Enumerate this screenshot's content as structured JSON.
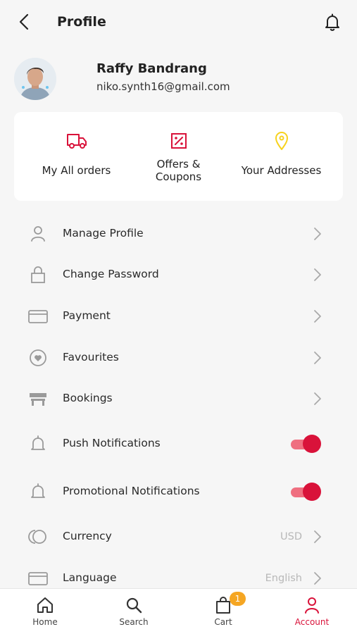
{
  "header": {
    "title": "Profile",
    "back_icon": "chevron-left-icon",
    "notification_icon": "bell-icon"
  },
  "user": {
    "name": "Raffy Bandrang",
    "email": "niko.synth16@gmail.com"
  },
  "quick_actions": [
    {
      "label": "My All orders",
      "icon": "truck-icon",
      "color": "#d9123a"
    },
    {
      "label_line1": "Offers &",
      "label_line2": "Coupons",
      "icon": "percent-icon",
      "color": "#d9123a"
    },
    {
      "label": "Your Addresses",
      "icon": "location-pin-icon",
      "color": "#f7d21e"
    }
  ],
  "menu": [
    {
      "label": "Manage Profile",
      "icon": "user-icon"
    },
    {
      "label": "Change Password",
      "icon": "lock-icon"
    },
    {
      "label": "Payment",
      "icon": "card-icon"
    },
    {
      "label": "Favourites",
      "icon": "heart-icon"
    },
    {
      "label": "Bookings",
      "icon": "bench-icon"
    },
    {
      "label": "Push Notifications",
      "icon": "bell-icon",
      "toggle_on": true
    },
    {
      "label": "Promotional Notifications",
      "icon": "bell-icon",
      "toggle_on": true
    },
    {
      "label": "Currency",
      "icon": "coins-icon",
      "value": "USD"
    },
    {
      "label": "Language",
      "icon": "card-icon",
      "value": "English"
    }
  ],
  "bottom_nav": [
    {
      "label": "Home",
      "icon": "home-icon"
    },
    {
      "label": "Search",
      "icon": "search-icon"
    },
    {
      "label": "Cart",
      "icon": "bag-icon",
      "badge": "1"
    },
    {
      "label": "Account",
      "icon": "user-icon",
      "active": true
    }
  ],
  "colors": {
    "accent": "#d9123a",
    "accent_light": "#ef6f80",
    "badge": "#f5a623",
    "pin": "#f7d21e"
  }
}
